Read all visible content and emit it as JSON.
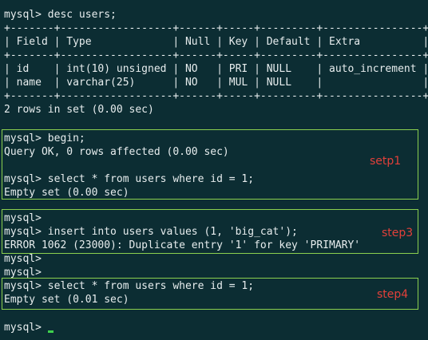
{
  "terminal": {
    "lines": [
      "mysql> desc users;",
      "+-------+------------------+------+-----+---------+----------------+",
      "| Field | Type             | Null | Key | Default | Extra          |",
      "+-------+------------------+------+-----+---------+----------------+",
      "| id    | int(10) unsigned | NO   | PRI | NULL    | auto_increment |",
      "| name  | varchar(25)      | NO   | MUL | NULL    |                |",
      "+-------+------------------+------+-----+---------+----------------+",
      "2 rows in set (0.00 sec)",
      "mysql> begin;",
      "Query OK, 0 rows affected (0.00 sec)",
      "mysql> select * from users where id = 1;",
      "Empty set (0.00 sec)",
      "mysql>",
      "mysql> insert into users values (1, 'big_cat');",
      "ERROR 1062 (23000): Duplicate entry '1' for key 'PRIMARY'",
      "mysql>",
      "mysql>",
      "mysql> select * from users where id = 1;",
      "Empty set (0.01 sec)",
      "mysql>"
    ],
    "steps": [
      "setp1",
      "step3",
      "step4"
    ],
    "colors": {
      "background": "#0c2d33",
      "text": "#e7edee",
      "box_border": "#8bd04f",
      "annotation": "#e2403a",
      "cursor": "#3ed14d"
    }
  }
}
